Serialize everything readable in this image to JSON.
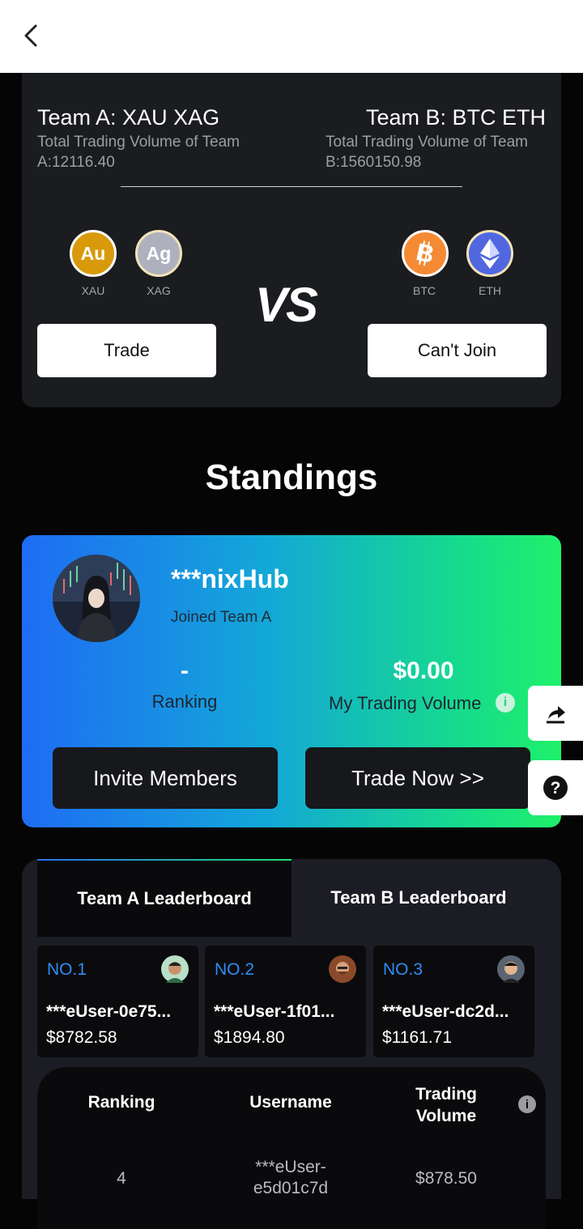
{
  "team_a": {
    "title": "Team A: XAU XAG",
    "volume_line1": "Total Trading Volume of Team",
    "volume_line2": "A:12116.40",
    "coins": [
      {
        "symbol": "Au",
        "label": "XAU",
        "color": "#d89a0b"
      },
      {
        "symbol": "Ag",
        "label": "XAG",
        "color": "#aeb1bd"
      }
    ],
    "button": "Trade"
  },
  "team_b": {
    "title": "Team B: BTC ETH",
    "volume_line1": "Total Trading Volume of Team",
    "volume_line2": "B:1560150.98",
    "coins": [
      {
        "symbol": "bitcoin-icon",
        "label": "BTC",
        "color": "#f48a33"
      },
      {
        "symbol": "ethereum-icon",
        "label": "ETH",
        "color": "#5067e0"
      }
    ],
    "button": "Can't Join"
  },
  "vs": "VS",
  "standings_title": "Standings",
  "user": {
    "name": "***nixHub",
    "joined": "Joined Team A",
    "ranking_value": "-",
    "ranking_label": "Ranking",
    "volume_value": "$0.00",
    "volume_label": "My Trading Volume",
    "invite_button": "Invite Members",
    "trade_button": "Trade Now >>"
  },
  "leaderboard": {
    "tabs": [
      "Team A Leaderboard",
      "Team B Leaderboard"
    ],
    "active_tab": 0,
    "top3": [
      {
        "no": "NO.1",
        "name": "***eUser-0e75...",
        "value": "$8782.58"
      },
      {
        "no": "NO.2",
        "name": "***eUser-1f01...",
        "value": "$1894.80"
      },
      {
        "no": "NO.3",
        "name": "***eUser-dc2d...",
        "value": "$1161.71"
      }
    ],
    "columns": [
      "Ranking",
      "Username",
      "Trading Volume"
    ],
    "rows": [
      {
        "rank": "4",
        "username_line1": "***eUser-",
        "username_line2": "e5d01c7d",
        "volume": "$878.50"
      }
    ]
  }
}
